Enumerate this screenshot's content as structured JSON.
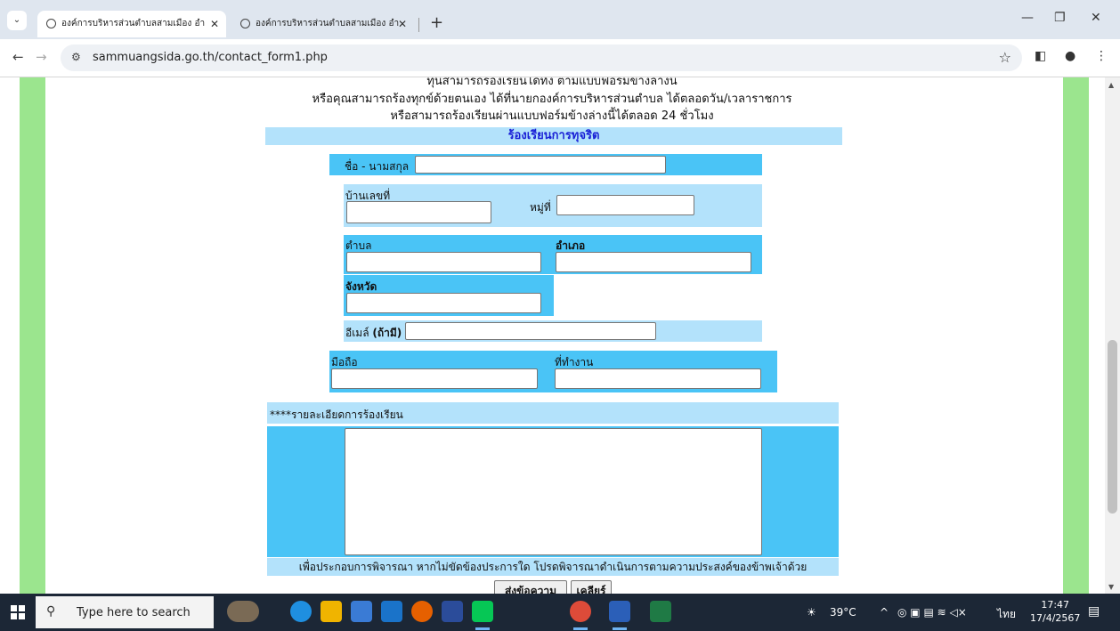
{
  "browser": {
    "tabs": [
      {
        "title": "องค์การบริหารส่วนตำบลสามเมือง อำ",
        "active": true
      },
      {
        "title": "องค์การบริหารส่วนตำบลสามเมือง อำ",
        "active": false
      }
    ],
    "url": "sammuangsida.go.th/contact_form1.php"
  },
  "page": {
    "intro_lines": [
      "ทุ่นสามารถร้องเรียนได้ทั้ง ตามแบบฟอร์มข้างล่างนี้",
      "หรือคุณสามารถร้องทุกข์ด้วยตนเอง ได้ที่นายกองค์การบริหารส่วนตำบล ได้ตลอดวัน/เวลาราชการ",
      "หรือสามารถร้องเรียนผ่านแบบฟอร์มข้างล่างนี้ได้ตลอด 24 ชั่วโมง"
    ],
    "form_title": "ร้องเรียนการทุจริต",
    "labels": {
      "full_name": "ชื่อ - นามสกุล",
      "house_no": "บ้านเลขที่",
      "moo": "หมู่ที่",
      "tambon": "ตำบล",
      "amphoe": "อำเภอ",
      "province": "จังหวัด",
      "email": "อีเมล์",
      "email_optional": "(ถ้ามี)",
      "mobile": "มือถือ",
      "workplace": "ที่ทำงาน",
      "details": "****รายละเอียดการร้องเรียน"
    },
    "note": "เพื่อประกอบการพิจารณา หากไม่ขัดข้องประการใด โปรดพิจารณาดำเนินการตามความประสงค์ของข้าพเจ้าด้วย",
    "buttons": {
      "submit": "ส่งข้อความ",
      "clear": "เคลียร์"
    }
  },
  "taskbar": {
    "search_placeholder": "Type here to search",
    "weather": "39°C",
    "language": "ไทย",
    "time": "17:47",
    "date": "17/4/2567"
  },
  "colors": {
    "green_side": "#9be58e",
    "light_blue": "#b3e2fb",
    "dark_blue": "#4ac4f6",
    "title_text": "#1a21d6"
  }
}
